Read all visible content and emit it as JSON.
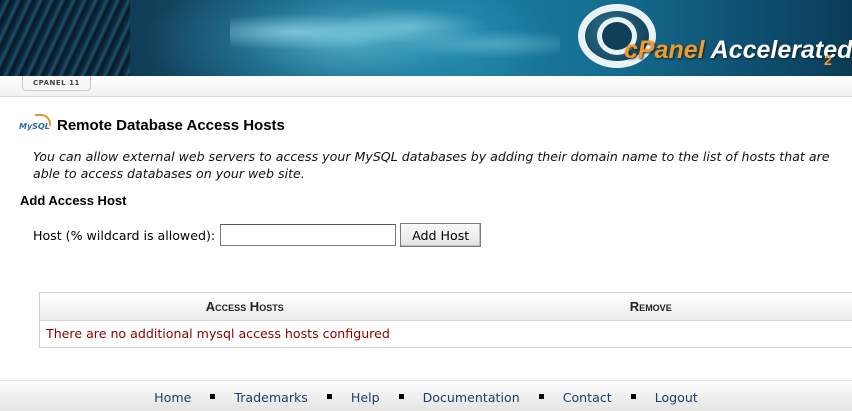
{
  "header": {
    "brand_prefix": "cPanel",
    "brand_main": "Accelerated",
    "brand_sub": "2",
    "version_tab": "CPANEL 11"
  },
  "page": {
    "title": "Remote Database Access Hosts",
    "icon": "mysql-icon",
    "intro": "You can allow external web servers to access your MySQL databases by adding their domain name to the list of hosts that are able to access databases on your web site."
  },
  "add_host": {
    "section_title": "Add Access Host",
    "label": "Host (% wildcard is allowed):",
    "value": "",
    "button": "Add Host"
  },
  "hosts_table": {
    "columns": [
      "Access Hosts",
      "Remove"
    ],
    "empty_message": "There are no additional mysql access hosts configured"
  },
  "footer": {
    "links": [
      "Home",
      "Trademarks",
      "Help",
      "Documentation",
      "Contact",
      "Logout"
    ]
  },
  "colors": {
    "empty_message": "#8b0000",
    "footer_link": "#17406c",
    "brand_accent": "#f39a2b"
  }
}
